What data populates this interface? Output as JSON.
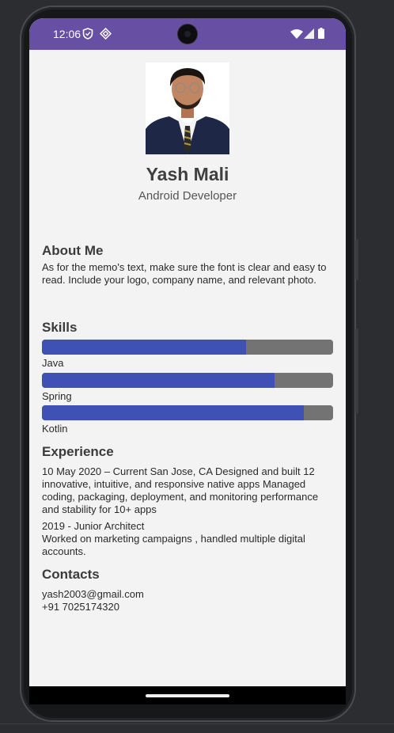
{
  "status_bar": {
    "time": "12:06"
  },
  "profile": {
    "name": "Yash Mali",
    "title": "Android Developer"
  },
  "about": {
    "heading": "About Me",
    "text": "As for the memo's text, make sure the font is clear and easy to read. Include your logo, company name, and relevant photo."
  },
  "skills": {
    "heading": "Skills",
    "items": [
      {
        "label": "Java",
        "level": 0.7
      },
      {
        "label": "Spring",
        "level": 0.8
      },
      {
        "label": "Kotlin",
        "level": 0.9
      }
    ]
  },
  "experience": {
    "heading": "Experience",
    "entries": [
      "10 May 2020 – Current San Jose, CA Designed and built 12 innovative, intuitive, and responsive native apps Managed coding, packaging, deployment, and monitoring performance and stability for 10+ apps",
      "2019 - Junior Architect",
      "Worked on marketing campaigns , handled multiple digital accounts."
    ]
  },
  "contacts": {
    "heading": "Contacts",
    "email": "yash2003@gmail.com",
    "phone": "+91 7025174320"
  },
  "colors": {
    "status_bar": "#6750a4",
    "bar_fill": "#3f51b5",
    "bar_track": "#737373",
    "screen_bg": "#f3f3f3"
  }
}
